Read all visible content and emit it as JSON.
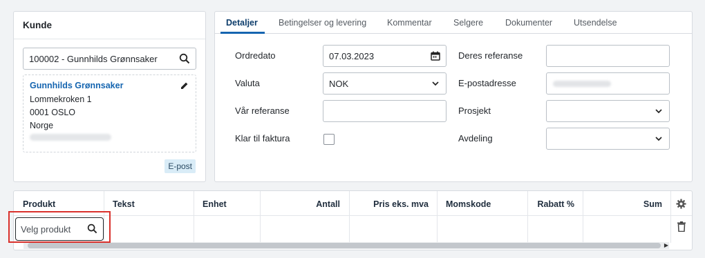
{
  "customer": {
    "title": "Kunde",
    "search_value": "100002 - Gunnhilds Grønnsaker",
    "name": "Gunnhilds Grønnsaker",
    "address1": "Lommekroken 1",
    "address2": "0001 OSLO",
    "country": "Norge",
    "email_badge": "E-post"
  },
  "tabs": [
    "Detaljer",
    "Betingelser og levering",
    "Kommentar",
    "Selgere",
    "Dokumenter",
    "Utsendelse"
  ],
  "details": {
    "order_date_label": "Ordredato",
    "order_date_value": "07.03.2023",
    "currency_label": "Valuta",
    "currency_value": "NOK",
    "our_ref_label": "Vår referanse",
    "ready_label": "Klar til faktura",
    "your_ref_label": "Deres referanse",
    "email_label": "E-postadresse",
    "project_label": "Prosjekt",
    "department_label": "Avdeling"
  },
  "lines": {
    "columns": [
      "Produkt",
      "Tekst",
      "Enhet",
      "Antall",
      "Pris eks. mva",
      "Momskode",
      "Rabatt %",
      "Sum"
    ],
    "product_placeholder": "Velg produkt"
  },
  "colors": {
    "accent": "#1565b0",
    "highlight": "#d9302b"
  }
}
